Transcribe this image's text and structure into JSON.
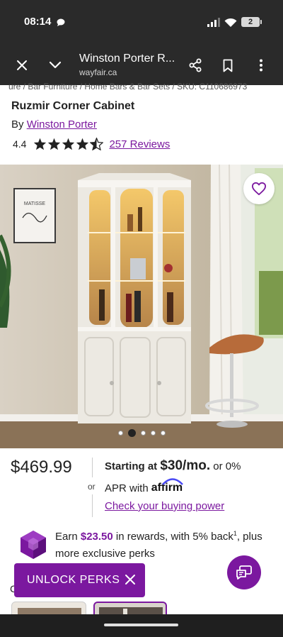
{
  "status_bar": {
    "time": "08:14",
    "battery_level": "2"
  },
  "browser": {
    "title": "Winston Porter R...",
    "url": "wayfair.ca",
    "icons": [
      "close-icon",
      "chevron-down-icon",
      "share-icon",
      "bookmark-icon",
      "more-vert-icon"
    ]
  },
  "breadcrumb": "ure  /  Bar Furniture  /  Home Bars & Bar Sets  /  SKU: C110686973",
  "product": {
    "title": "Ruzmir Corner Cabinet",
    "by_prefix": "By ",
    "brand": "Winston Porter",
    "rating": "4.4",
    "stars_filled": 4.4,
    "stars_total": 5,
    "reviews": "257 Reviews"
  },
  "gallery": {
    "slide_count": 5,
    "active_slide": 1,
    "poster_text": "MATISSE"
  },
  "pricing": {
    "price": "$469.99",
    "or_label": "or",
    "starting_prefix": "Starting at ",
    "monthly": "$30/mo.",
    "or_zero": " or 0%",
    "apr_prefix": "APR with",
    "affirm": "affirm",
    "buying_power": "Check your buying power"
  },
  "rewards": {
    "earn_prefix": "Earn ",
    "amount": "$23.50",
    "middle": " in rewards, with 5% back",
    "sup": "1",
    "suffix": ", plus more exclusive perks"
  },
  "unlock": {
    "label": "UNLOCK PERKS"
  },
  "partial_section": {
    "letter": "C"
  },
  "colors": {
    "brand_purple": "#7b189f",
    "chrome_dark": "#2a2a2a"
  }
}
